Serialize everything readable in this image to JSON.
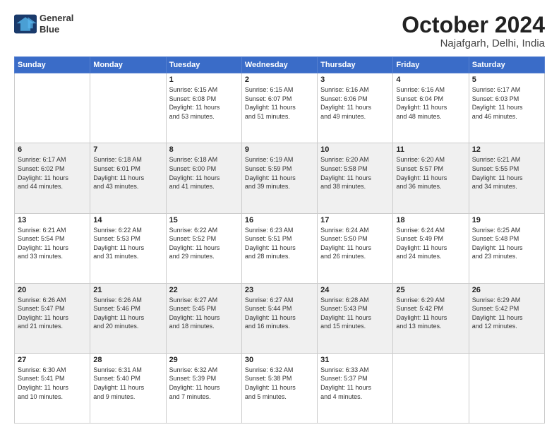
{
  "header": {
    "logo_line1": "General",
    "logo_line2": "Blue",
    "month": "October 2024",
    "location": "Najafgarh, Delhi, India"
  },
  "weekdays": [
    "Sunday",
    "Monday",
    "Tuesday",
    "Wednesday",
    "Thursday",
    "Friday",
    "Saturday"
  ],
  "rows": [
    {
      "shade": "white",
      "cells": [
        {
          "empty": true
        },
        {
          "empty": true
        },
        {
          "day": "1",
          "info": "Sunrise: 6:15 AM\nSunset: 6:08 PM\nDaylight: 11 hours\nand 53 minutes."
        },
        {
          "day": "2",
          "info": "Sunrise: 6:15 AM\nSunset: 6:07 PM\nDaylight: 11 hours\nand 51 minutes."
        },
        {
          "day": "3",
          "info": "Sunrise: 6:16 AM\nSunset: 6:06 PM\nDaylight: 11 hours\nand 49 minutes."
        },
        {
          "day": "4",
          "info": "Sunrise: 6:16 AM\nSunset: 6:04 PM\nDaylight: 11 hours\nand 48 minutes."
        },
        {
          "day": "5",
          "info": "Sunrise: 6:17 AM\nSunset: 6:03 PM\nDaylight: 11 hours\nand 46 minutes."
        }
      ]
    },
    {
      "shade": "shaded",
      "cells": [
        {
          "day": "6",
          "info": "Sunrise: 6:17 AM\nSunset: 6:02 PM\nDaylight: 11 hours\nand 44 minutes."
        },
        {
          "day": "7",
          "info": "Sunrise: 6:18 AM\nSunset: 6:01 PM\nDaylight: 11 hours\nand 43 minutes."
        },
        {
          "day": "8",
          "info": "Sunrise: 6:18 AM\nSunset: 6:00 PM\nDaylight: 11 hours\nand 41 minutes."
        },
        {
          "day": "9",
          "info": "Sunrise: 6:19 AM\nSunset: 5:59 PM\nDaylight: 11 hours\nand 39 minutes."
        },
        {
          "day": "10",
          "info": "Sunrise: 6:20 AM\nSunset: 5:58 PM\nDaylight: 11 hours\nand 38 minutes."
        },
        {
          "day": "11",
          "info": "Sunrise: 6:20 AM\nSunset: 5:57 PM\nDaylight: 11 hours\nand 36 minutes."
        },
        {
          "day": "12",
          "info": "Sunrise: 6:21 AM\nSunset: 5:55 PM\nDaylight: 11 hours\nand 34 minutes."
        }
      ]
    },
    {
      "shade": "white",
      "cells": [
        {
          "day": "13",
          "info": "Sunrise: 6:21 AM\nSunset: 5:54 PM\nDaylight: 11 hours\nand 33 minutes."
        },
        {
          "day": "14",
          "info": "Sunrise: 6:22 AM\nSunset: 5:53 PM\nDaylight: 11 hours\nand 31 minutes."
        },
        {
          "day": "15",
          "info": "Sunrise: 6:22 AM\nSunset: 5:52 PM\nDaylight: 11 hours\nand 29 minutes."
        },
        {
          "day": "16",
          "info": "Sunrise: 6:23 AM\nSunset: 5:51 PM\nDaylight: 11 hours\nand 28 minutes."
        },
        {
          "day": "17",
          "info": "Sunrise: 6:24 AM\nSunset: 5:50 PM\nDaylight: 11 hours\nand 26 minutes."
        },
        {
          "day": "18",
          "info": "Sunrise: 6:24 AM\nSunset: 5:49 PM\nDaylight: 11 hours\nand 24 minutes."
        },
        {
          "day": "19",
          "info": "Sunrise: 6:25 AM\nSunset: 5:48 PM\nDaylight: 11 hours\nand 23 minutes."
        }
      ]
    },
    {
      "shade": "shaded",
      "cells": [
        {
          "day": "20",
          "info": "Sunrise: 6:26 AM\nSunset: 5:47 PM\nDaylight: 11 hours\nand 21 minutes."
        },
        {
          "day": "21",
          "info": "Sunrise: 6:26 AM\nSunset: 5:46 PM\nDaylight: 11 hours\nand 20 minutes."
        },
        {
          "day": "22",
          "info": "Sunrise: 6:27 AM\nSunset: 5:45 PM\nDaylight: 11 hours\nand 18 minutes."
        },
        {
          "day": "23",
          "info": "Sunrise: 6:27 AM\nSunset: 5:44 PM\nDaylight: 11 hours\nand 16 minutes."
        },
        {
          "day": "24",
          "info": "Sunrise: 6:28 AM\nSunset: 5:43 PM\nDaylight: 11 hours\nand 15 minutes."
        },
        {
          "day": "25",
          "info": "Sunrise: 6:29 AM\nSunset: 5:42 PM\nDaylight: 11 hours\nand 13 minutes."
        },
        {
          "day": "26",
          "info": "Sunrise: 6:29 AM\nSunset: 5:42 PM\nDaylight: 11 hours\nand 12 minutes."
        }
      ]
    },
    {
      "shade": "white",
      "cells": [
        {
          "day": "27",
          "info": "Sunrise: 6:30 AM\nSunset: 5:41 PM\nDaylight: 11 hours\nand 10 minutes."
        },
        {
          "day": "28",
          "info": "Sunrise: 6:31 AM\nSunset: 5:40 PM\nDaylight: 11 hours\nand 9 minutes."
        },
        {
          "day": "29",
          "info": "Sunrise: 6:32 AM\nSunset: 5:39 PM\nDaylight: 11 hours\nand 7 minutes."
        },
        {
          "day": "30",
          "info": "Sunrise: 6:32 AM\nSunset: 5:38 PM\nDaylight: 11 hours\nand 5 minutes."
        },
        {
          "day": "31",
          "info": "Sunrise: 6:33 AM\nSunset: 5:37 PM\nDaylight: 11 hours\nand 4 minutes."
        },
        {
          "empty": true
        },
        {
          "empty": true
        }
      ]
    }
  ]
}
